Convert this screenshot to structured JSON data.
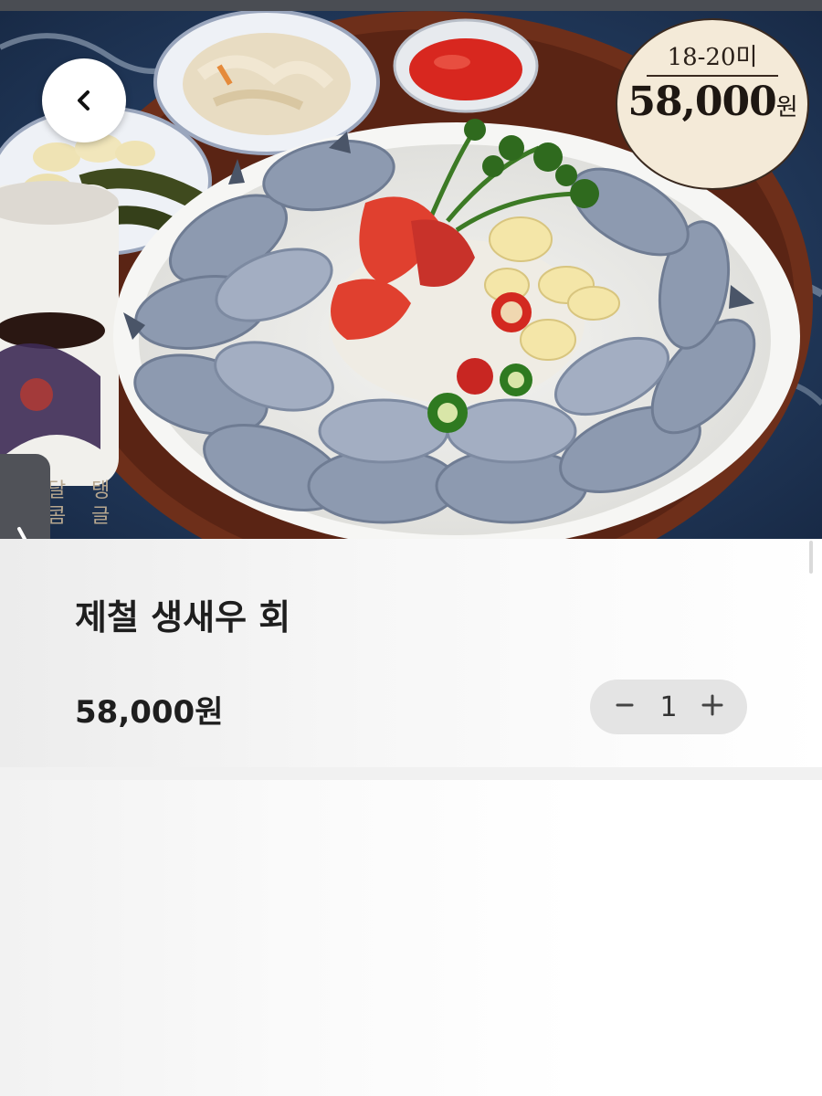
{
  "header": {
    "back_icon": "chevron-left-icon"
  },
  "hero": {
    "image_subject": "shrimp-sashimi-platter",
    "badge_quantity": "18-20미",
    "badge_price": "58,000",
    "badge_currency": "원",
    "vertical_text_col1": "달 콤",
    "vertical_text_col2": "탱 글"
  },
  "side_handle": {
    "icon": "chevron-right-icon"
  },
  "product": {
    "name": "제철 생새우 회",
    "price": "58,000원"
  },
  "quantity_stepper": {
    "minus_icon": "minus-icon",
    "value": "1",
    "plus_icon": "plus-icon"
  },
  "colors": {
    "stepper_bg": "#e4e4e4",
    "text_primary": "#1e1e1e",
    "side_handle_bg": "#505258"
  }
}
